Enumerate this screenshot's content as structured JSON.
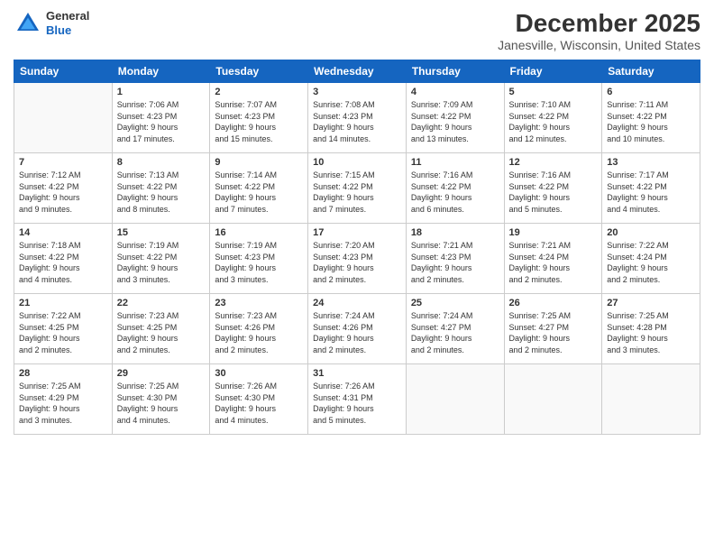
{
  "header": {
    "logo_line1": "General",
    "logo_line2": "Blue",
    "month_title": "December 2025",
    "location": "Janesville, Wisconsin, United States"
  },
  "days_of_week": [
    "Sunday",
    "Monday",
    "Tuesday",
    "Wednesday",
    "Thursday",
    "Friday",
    "Saturday"
  ],
  "weeks": [
    [
      {
        "day": "",
        "info": ""
      },
      {
        "day": "1",
        "info": "Sunrise: 7:06 AM\nSunset: 4:23 PM\nDaylight: 9 hours\nand 17 minutes."
      },
      {
        "day": "2",
        "info": "Sunrise: 7:07 AM\nSunset: 4:23 PM\nDaylight: 9 hours\nand 15 minutes."
      },
      {
        "day": "3",
        "info": "Sunrise: 7:08 AM\nSunset: 4:23 PM\nDaylight: 9 hours\nand 14 minutes."
      },
      {
        "day": "4",
        "info": "Sunrise: 7:09 AM\nSunset: 4:22 PM\nDaylight: 9 hours\nand 13 minutes."
      },
      {
        "day": "5",
        "info": "Sunrise: 7:10 AM\nSunset: 4:22 PM\nDaylight: 9 hours\nand 12 minutes."
      },
      {
        "day": "6",
        "info": "Sunrise: 7:11 AM\nSunset: 4:22 PM\nDaylight: 9 hours\nand 10 minutes."
      }
    ],
    [
      {
        "day": "7",
        "info": "Sunrise: 7:12 AM\nSunset: 4:22 PM\nDaylight: 9 hours\nand 9 minutes."
      },
      {
        "day": "8",
        "info": "Sunrise: 7:13 AM\nSunset: 4:22 PM\nDaylight: 9 hours\nand 8 minutes."
      },
      {
        "day": "9",
        "info": "Sunrise: 7:14 AM\nSunset: 4:22 PM\nDaylight: 9 hours\nand 7 minutes."
      },
      {
        "day": "10",
        "info": "Sunrise: 7:15 AM\nSunset: 4:22 PM\nDaylight: 9 hours\nand 7 minutes."
      },
      {
        "day": "11",
        "info": "Sunrise: 7:16 AM\nSunset: 4:22 PM\nDaylight: 9 hours\nand 6 minutes."
      },
      {
        "day": "12",
        "info": "Sunrise: 7:16 AM\nSunset: 4:22 PM\nDaylight: 9 hours\nand 5 minutes."
      },
      {
        "day": "13",
        "info": "Sunrise: 7:17 AM\nSunset: 4:22 PM\nDaylight: 9 hours\nand 4 minutes."
      }
    ],
    [
      {
        "day": "14",
        "info": "Sunrise: 7:18 AM\nSunset: 4:22 PM\nDaylight: 9 hours\nand 4 minutes."
      },
      {
        "day": "15",
        "info": "Sunrise: 7:19 AM\nSunset: 4:22 PM\nDaylight: 9 hours\nand 3 minutes."
      },
      {
        "day": "16",
        "info": "Sunrise: 7:19 AM\nSunset: 4:23 PM\nDaylight: 9 hours\nand 3 minutes."
      },
      {
        "day": "17",
        "info": "Sunrise: 7:20 AM\nSunset: 4:23 PM\nDaylight: 9 hours\nand 2 minutes."
      },
      {
        "day": "18",
        "info": "Sunrise: 7:21 AM\nSunset: 4:23 PM\nDaylight: 9 hours\nand 2 minutes."
      },
      {
        "day": "19",
        "info": "Sunrise: 7:21 AM\nSunset: 4:24 PM\nDaylight: 9 hours\nand 2 minutes."
      },
      {
        "day": "20",
        "info": "Sunrise: 7:22 AM\nSunset: 4:24 PM\nDaylight: 9 hours\nand 2 minutes."
      }
    ],
    [
      {
        "day": "21",
        "info": "Sunrise: 7:22 AM\nSunset: 4:25 PM\nDaylight: 9 hours\nand 2 minutes."
      },
      {
        "day": "22",
        "info": "Sunrise: 7:23 AM\nSunset: 4:25 PM\nDaylight: 9 hours\nand 2 minutes."
      },
      {
        "day": "23",
        "info": "Sunrise: 7:23 AM\nSunset: 4:26 PM\nDaylight: 9 hours\nand 2 minutes."
      },
      {
        "day": "24",
        "info": "Sunrise: 7:24 AM\nSunset: 4:26 PM\nDaylight: 9 hours\nand 2 minutes."
      },
      {
        "day": "25",
        "info": "Sunrise: 7:24 AM\nSunset: 4:27 PM\nDaylight: 9 hours\nand 2 minutes."
      },
      {
        "day": "26",
        "info": "Sunrise: 7:25 AM\nSunset: 4:27 PM\nDaylight: 9 hours\nand 2 minutes."
      },
      {
        "day": "27",
        "info": "Sunrise: 7:25 AM\nSunset: 4:28 PM\nDaylight: 9 hours\nand 3 minutes."
      }
    ],
    [
      {
        "day": "28",
        "info": "Sunrise: 7:25 AM\nSunset: 4:29 PM\nDaylight: 9 hours\nand 3 minutes."
      },
      {
        "day": "29",
        "info": "Sunrise: 7:25 AM\nSunset: 4:30 PM\nDaylight: 9 hours\nand 4 minutes."
      },
      {
        "day": "30",
        "info": "Sunrise: 7:26 AM\nSunset: 4:30 PM\nDaylight: 9 hours\nand 4 minutes."
      },
      {
        "day": "31",
        "info": "Sunrise: 7:26 AM\nSunset: 4:31 PM\nDaylight: 9 hours\nand 5 minutes."
      },
      {
        "day": "",
        "info": ""
      },
      {
        "day": "",
        "info": ""
      },
      {
        "day": "",
        "info": ""
      }
    ]
  ]
}
